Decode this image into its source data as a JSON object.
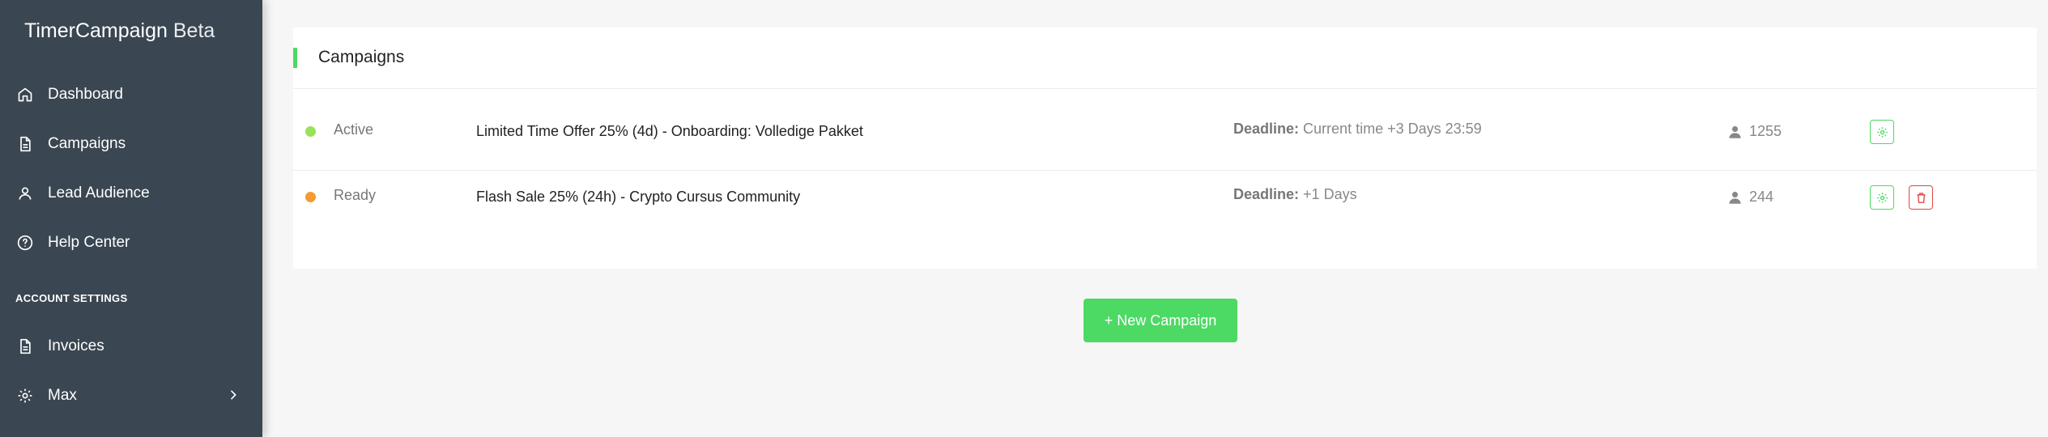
{
  "app": {
    "name": "TimerCampaign",
    "badge": "Beta"
  },
  "sidebar": {
    "items": [
      {
        "label": "Dashboard",
        "icon": "home-icon"
      },
      {
        "label": "Campaigns",
        "icon": "document-icon"
      },
      {
        "label": "Lead Audience",
        "icon": "user-icon"
      },
      {
        "label": "Help Center",
        "icon": "help-circle-icon"
      }
    ],
    "section_label": "ACCOUNT SETTINGS",
    "account_items": [
      {
        "label": "Invoices",
        "icon": "document-icon"
      },
      {
        "label": "Max",
        "icon": "gear-icon"
      }
    ]
  },
  "main": {
    "card_title": "Campaigns",
    "deadline_label": "Deadline:",
    "campaigns": [
      {
        "status": "Active",
        "status_color": "#9be05a",
        "name": "Limited Time Offer 25% (4d) - Onboarding: Volledige Pakket",
        "deadline": "Current time +3 Days 23:59",
        "count": "1255",
        "actions": [
          "settings"
        ]
      },
      {
        "status": "Ready",
        "status_color": "#f39c32",
        "name": "Flash Sale 25% (24h) - Crypto Cursus Community",
        "deadline": "+1 Days",
        "count": "244",
        "actions": [
          "settings",
          "delete"
        ]
      }
    ],
    "new_button": "+ New Campaign"
  },
  "colors": {
    "sidebar_bg": "#3a4651",
    "accent_green": "#4cd964",
    "danger_red": "#e04545",
    "page_bg": "#f6f6f6"
  }
}
